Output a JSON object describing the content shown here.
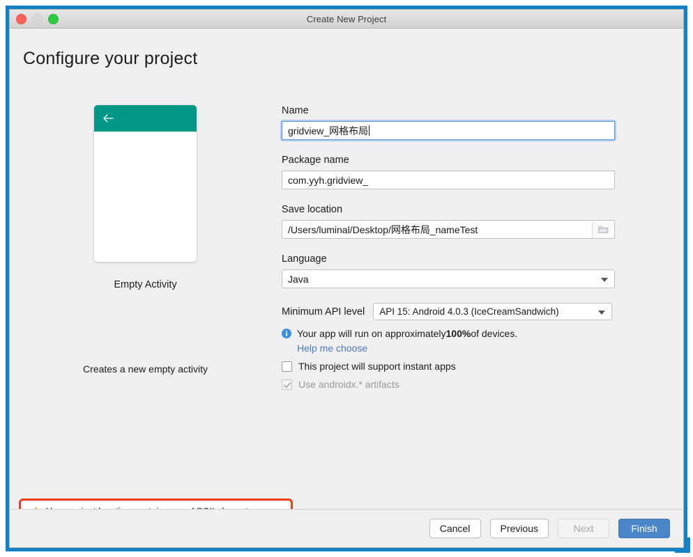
{
  "window": {
    "title": "Create New Project",
    "traffic_lights": [
      "close",
      "minimize",
      "zoom"
    ]
  },
  "page": {
    "title": "Configure your project"
  },
  "preview": {
    "activity_name": "Empty Activity",
    "activity_description": "Creates a new empty activity",
    "appbar_color": "#009688",
    "back_icon": "back-arrow-icon"
  },
  "form": {
    "name": {
      "label": "Name",
      "value": "gridview_网格布局",
      "focused": true
    },
    "package_name": {
      "label": "Package name",
      "value": "com.yyh.gridview_"
    },
    "save_location": {
      "label": "Save location",
      "value": "/Users/luminal/Desktop/网格布局_nameTest",
      "browse_icon": "folder-icon"
    },
    "language": {
      "label": "Language",
      "value": "Java"
    },
    "min_api": {
      "label": "Minimum API level",
      "value": "API 15: Android 4.0.3 (IceCreamSandwich)"
    },
    "device_support": {
      "icon": "info-icon",
      "text_before": "Your app will run on approximately ",
      "percent": "100%",
      "text_after": " of devices.",
      "help_link": "Help me choose"
    },
    "instant_apps": {
      "label": "This project will support instant apps",
      "checked": false
    },
    "androidx": {
      "label": "Use androidx.* artifacts",
      "checked": true,
      "disabled": true
    }
  },
  "warning": {
    "icon": "warning-triangle-icon",
    "text": "Your project location contains non-ASCII characters.",
    "annotation_color": "#f03c16"
  },
  "footer": {
    "cancel": "Cancel",
    "previous": "Previous",
    "next": "Next",
    "finish": "Finish",
    "primary_color": "#4a86c8"
  }
}
